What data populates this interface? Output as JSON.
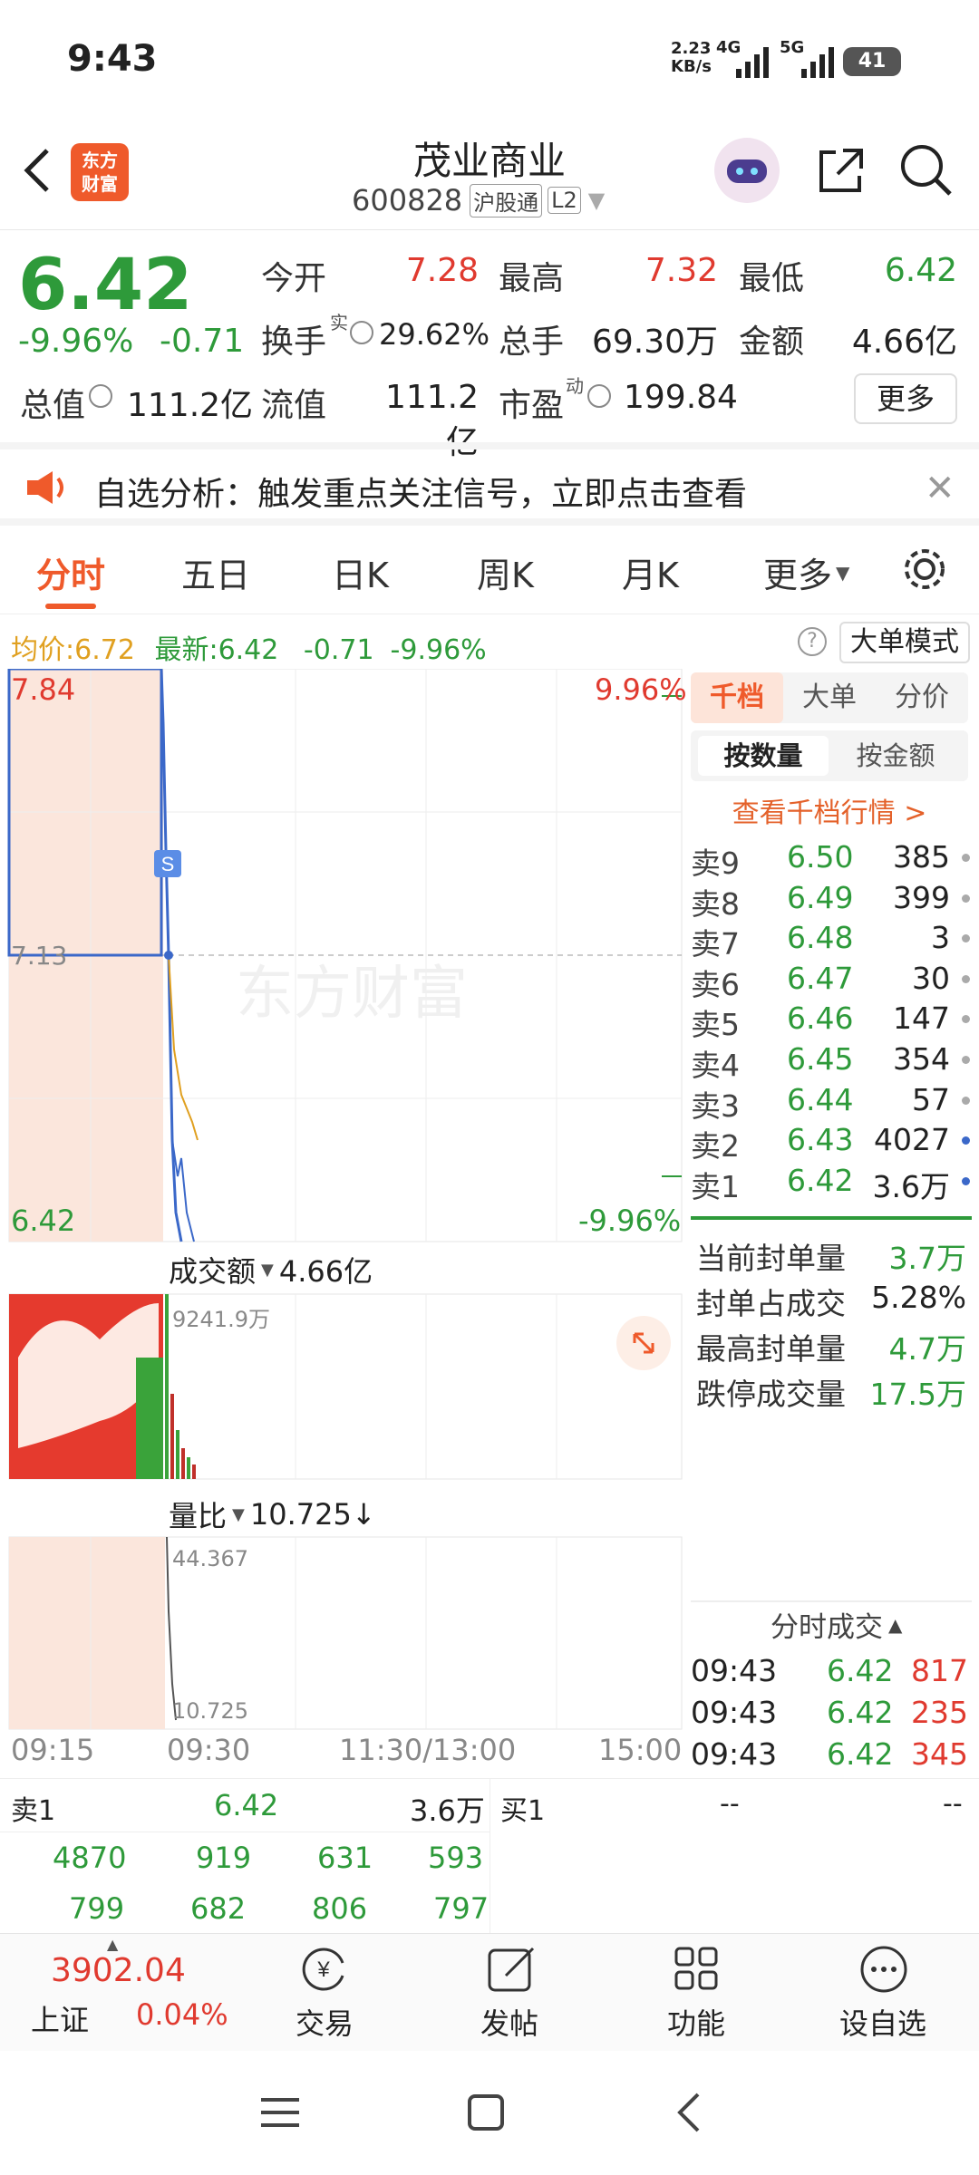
{
  "status": {
    "time": "9:43",
    "net_speed": "2.23",
    "net_unit": "KB/s",
    "net_4g": "4G",
    "net_5g": "5G",
    "battery": "41"
  },
  "header": {
    "logo_line1": "东方",
    "logo_line2": "财富",
    "title": "茂业商业",
    "code": "600828",
    "badge_hgt": "沪股通",
    "badge_l2": "L2"
  },
  "quote": {
    "price": "6.42",
    "pct": "-9.96%",
    "chg": "-0.71",
    "open_label": "今开",
    "open": "7.28",
    "high_label": "最高",
    "high": "7.32",
    "low_label": "最低",
    "low": "6.42",
    "turnover_label": "换手",
    "turnover_sup": "实",
    "turnover": "29.62%",
    "volume_label": "总手",
    "volume": "69.30万",
    "amount_label": "金额",
    "amount": "4.66亿",
    "mktcap_label": "总值",
    "mktcap": "111.2亿",
    "float_label": "流值",
    "float": "111.2亿",
    "pe_label": "市盈",
    "pe_sup": "动",
    "pe": "199.84",
    "more_label": "更多"
  },
  "banner": {
    "text": "自选分析：触发重点关注信号，立即点击查看"
  },
  "tabs": [
    "分时",
    "五日",
    "日K",
    "周K",
    "月K",
    "更多"
  ],
  "chart_info": {
    "avg_label": "均价:",
    "avg": "6.72",
    "latest_label": "最新:",
    "latest": "6.42",
    "chg": "-0.71",
    "pct": "-9.96%",
    "mode_label": "大单模式"
  },
  "chart_data": {
    "type": "line",
    "y_max_label": "7.84",
    "y_mid_label": "7.13",
    "y_min_label": "6.42",
    "pct_max_label": "9.96%",
    "pct_min_label": "-9.96%",
    "x_labels": [
      "09:15",
      "09:30",
      "11:30/13:00",
      "15:00"
    ],
    "watermark": "东方财富",
    "amount_label": "成交额",
    "amount_total": "4.66亿",
    "amount_max": "9241.9万",
    "ratio_label": "量比",
    "ratio_value": "10.725↓",
    "ratio_max": "44.367",
    "ratio_min": "10.725",
    "s_marker": "S"
  },
  "orderbook": {
    "tab_qiandang": "千档",
    "tab_dadan": "大单",
    "tab_fenjia": "分价",
    "btn_qty": "按数量",
    "btn_amt": "按金额",
    "view_link": "查看千档行情 >",
    "asks": [
      {
        "label": "卖9",
        "price": "6.50",
        "vol": "385"
      },
      {
        "label": "卖8",
        "price": "6.49",
        "vol": "399"
      },
      {
        "label": "卖7",
        "price": "6.48",
        "vol": "3"
      },
      {
        "label": "卖6",
        "price": "6.47",
        "vol": "30"
      },
      {
        "label": "卖5",
        "price": "6.46",
        "vol": "147"
      },
      {
        "label": "卖4",
        "price": "6.45",
        "vol": "354"
      },
      {
        "label": "卖3",
        "price": "6.44",
        "vol": "57"
      },
      {
        "label": "卖2",
        "price": "6.43",
        "vol": "4027"
      },
      {
        "label": "卖1",
        "price": "6.42",
        "vol": "3.6万"
      }
    ],
    "stats": [
      {
        "label": "当前封单量",
        "value": "3.7万"
      },
      {
        "label": "封单占成交",
        "value": "5.28%"
      },
      {
        "label": "最高封单量",
        "value": "4.7万"
      },
      {
        "label": "跌停成交量",
        "value": "17.5万"
      }
    ],
    "ticks_title": "分时成交",
    "ticks": [
      {
        "time": "09:43",
        "price": "6.42",
        "vol": "817"
      },
      {
        "time": "09:43",
        "price": "6.42",
        "vol": "235"
      },
      {
        "time": "09:43",
        "price": "6.42",
        "vol": "345"
      }
    ]
  },
  "level": {
    "sell1_label": "卖1",
    "sell1_price": "6.42",
    "sell1_vol": "3.6万",
    "buy1_label": "买1",
    "buy1_price": "--",
    "buy1_vol": "--",
    "queue_row1": [
      "4870",
      "919",
      "631",
      "593"
    ],
    "queue_row2": [
      "799",
      "682",
      "806",
      "797"
    ]
  },
  "bottom": {
    "index_value": "3902.04",
    "index_name": "上证",
    "index_pct": "0.04%",
    "trade": "交易",
    "post": "发帖",
    "func": "功能",
    "add": "设自选"
  }
}
